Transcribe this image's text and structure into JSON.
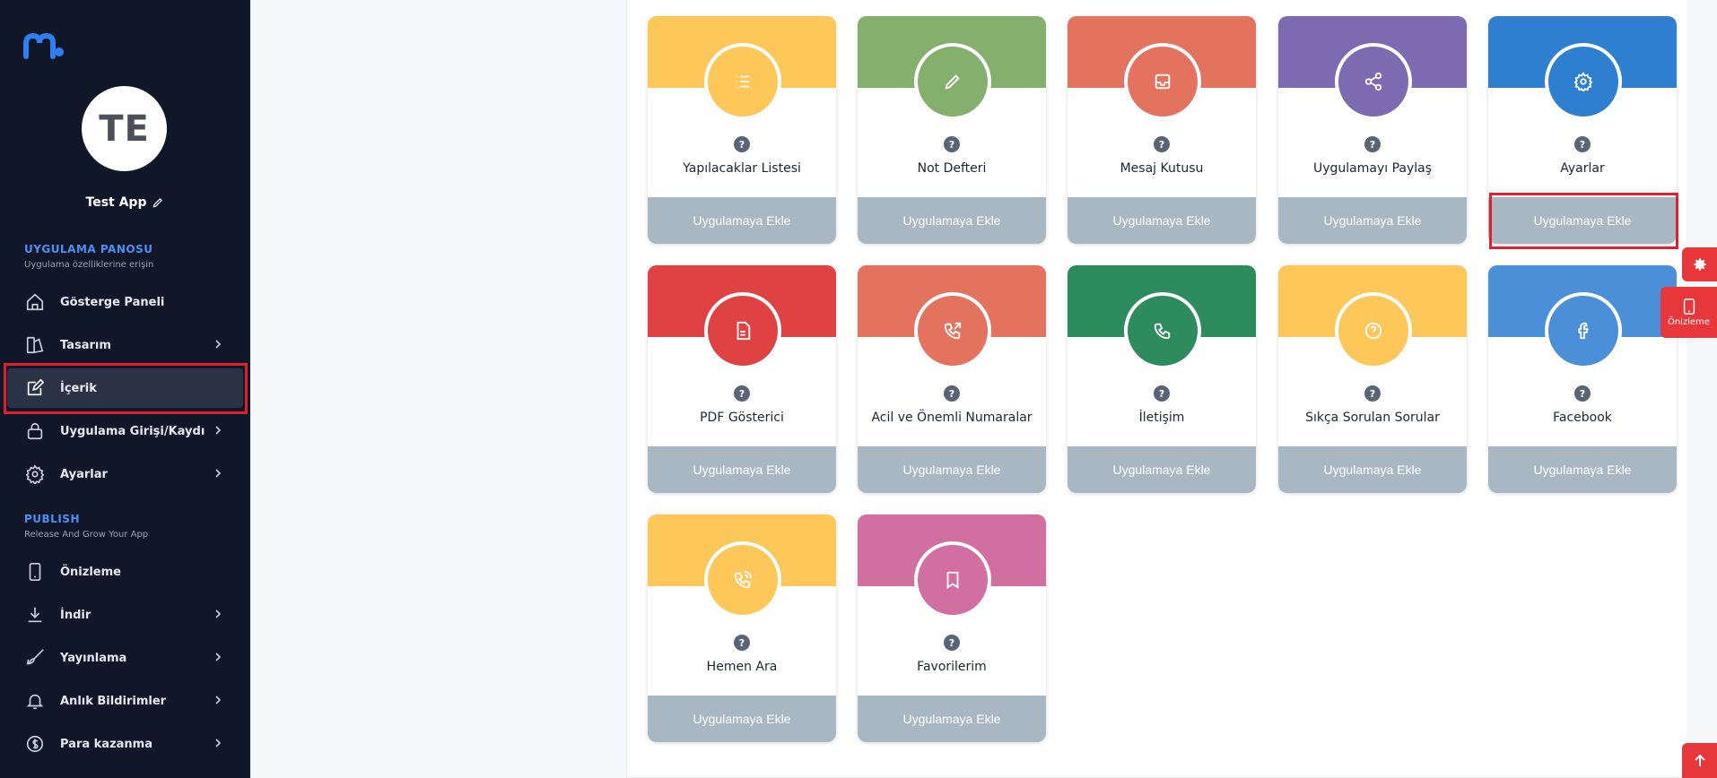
{
  "sidebar": {
    "avatar_initials": "TE",
    "app_name": "Test App",
    "section_dashboard": {
      "title": "UYGULAMA PANOSU",
      "subtitle": "Uygulama özelliklerine erişin"
    },
    "section_publish": {
      "title": "PUBLISH",
      "subtitle": "Release And Grow Your App"
    },
    "items": [
      {
        "label": "Gösterge Paneli",
        "icon": "home-icon"
      },
      {
        "label": "Tasarım",
        "icon": "design-icon"
      },
      {
        "label": "İçerik",
        "icon": "edit-icon"
      },
      {
        "label": "Uygulama Girişi/Kaydı",
        "icon": "lock-icon"
      },
      {
        "label": "Ayarlar",
        "icon": "gear-icon"
      },
      {
        "label": "Önizleme",
        "icon": "mobile-icon"
      },
      {
        "label": "İndir",
        "icon": "download-icon"
      },
      {
        "label": "Yayınlama",
        "icon": "rocket-icon"
      },
      {
        "label": "Anlık Bildirimler",
        "icon": "bell-icon"
      },
      {
        "label": "Para kazanma",
        "icon": "dollar-icon"
      }
    ]
  },
  "features": {
    "help_mark": "?",
    "add_label": "Uygulamaya Ekle",
    "cards": [
      {
        "title": "Yapılacaklar Listesi",
        "color": "#fdc75a",
        "icon": "list-icon"
      },
      {
        "title": "Not Defteri",
        "color": "#84af6d",
        "icon": "pencil-icon"
      },
      {
        "title": "Mesaj Kutusu",
        "color": "#e3735e",
        "icon": "inbox-icon"
      },
      {
        "title": "Uygulamayı Paylaş",
        "color": "#7c6bb0",
        "icon": "share-icon"
      },
      {
        "title": "Ayarlar",
        "color": "#2f7fd1",
        "icon": "gear-icon"
      },
      {
        "title": "PDF Gösterici",
        "color": "#df4242",
        "icon": "file-icon"
      },
      {
        "title": "Acil ve Önemli Numaralar",
        "color": "#e3735e",
        "icon": "phone-outgoing-icon"
      },
      {
        "title": "İletişim",
        "color": "#2e8b5e",
        "icon": "phone-icon"
      },
      {
        "title": "Sıkça Sorulan Sorular",
        "color": "#fdc75a",
        "icon": "help-icon"
      },
      {
        "title": "Facebook",
        "color": "#4a8fd8",
        "icon": "facebook-icon"
      },
      {
        "title": "Hemen Ara",
        "color": "#fdc75a",
        "icon": "phone-call-icon"
      },
      {
        "title": "Favorilerim",
        "color": "#d06fa0",
        "icon": "bookmark-icon"
      }
    ]
  },
  "floating": {
    "preview_label": "Önizleme"
  },
  "colors": {
    "sidebar_bg": "#0f1729",
    "accent": "#4f8ef7",
    "float_red": "#e8373b",
    "highlight": "#e0202a",
    "add_button": "#a9b7c2"
  }
}
